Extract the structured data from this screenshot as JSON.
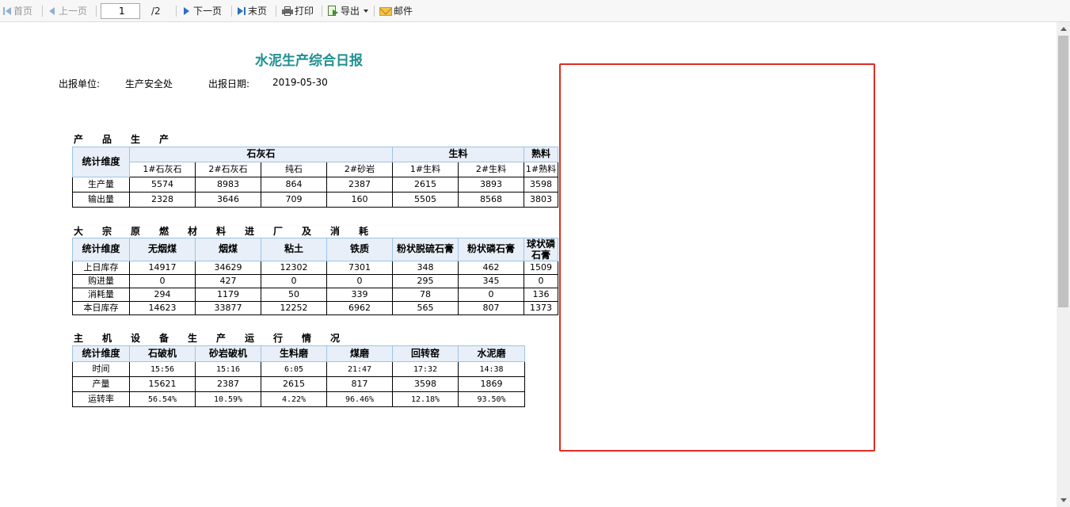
{
  "toolbar": {
    "first": "首页",
    "prev": "上一页",
    "page_value": "1",
    "page_total": "/2",
    "next": "下一页",
    "last": "末页",
    "print": "打印",
    "export": "导出",
    "mail": "邮件"
  },
  "report": {
    "title": "水泥生产综合日报",
    "unit_label": "出报单位:",
    "unit_value": "生产安全处",
    "date_label": "出报日期:",
    "date_value": "2019-05-30"
  },
  "section1": {
    "title": "产　　品　　生　　产",
    "dim": "统计维度",
    "groups": [
      "石灰石",
      "生料",
      "熟料"
    ],
    "columns": [
      "1#石灰石",
      "2#石灰石",
      "纯石",
      "2#砂岩",
      "1#生料",
      "2#生料",
      "1#熟料"
    ],
    "rows": [
      {
        "label": "生产量",
        "values": [
          "5574",
          "8983",
          "864",
          "2387",
          "2615",
          "3893",
          "3598"
        ]
      },
      {
        "label": "输出量",
        "values": [
          "2328",
          "3646",
          "709",
          "160",
          "5505",
          "8568",
          "3803"
        ]
      }
    ]
  },
  "section2": {
    "title": "大　　宗　　原　　燃　　材　　料　　进　　厂　　及　　消　　耗",
    "dim": "统计维度",
    "columns": [
      "无烟煤",
      "烟煤",
      "粘土",
      "铁质",
      "粉状脱硫石膏",
      "粉状磷石膏",
      "球状磷石膏"
    ],
    "rows": [
      {
        "label": "上日库存",
        "values": [
          "14917",
          "34629",
          "12302",
          "7301",
          "348",
          "462",
          "1509"
        ]
      },
      {
        "label": "购进量",
        "values": [
          "0",
          "427",
          "0",
          "0",
          "295",
          "345",
          "0"
        ]
      },
      {
        "label": "消耗量",
        "values": [
          "294",
          "1179",
          "50",
          "339",
          "78",
          "0",
          "136"
        ]
      },
      {
        "label": "本日库存",
        "values": [
          "14623",
          "33877",
          "12252",
          "6962",
          "565",
          "807",
          "1373"
        ]
      }
    ]
  },
  "section3": {
    "title": "主　　机　　设　　备　　生　　产　　运　　行　　情　　况",
    "dim": "统计维度",
    "columns": [
      "石破机",
      "砂岩破机",
      "生料磨",
      "煤磨",
      "回转窑",
      "水泥磨"
    ],
    "rows": [
      {
        "label": "时间",
        "values": [
          "15:56",
          "15:16",
          "6:05",
          "21:47",
          "17:32",
          "14:38"
        ]
      },
      {
        "label": "产量",
        "values": [
          "15621",
          "2387",
          "2615",
          "817",
          "3598",
          "1869"
        ]
      },
      {
        "label": "运转率",
        "values": [
          "56.54%",
          "10.59%",
          "4.22%",
          "96.46%",
          "12.18%",
          "93.50%"
        ]
      }
    ]
  },
  "colors": {
    "title": "#1f8f91",
    "header_bg": "#e8eff8",
    "highlight_border": "#e02b1f"
  }
}
